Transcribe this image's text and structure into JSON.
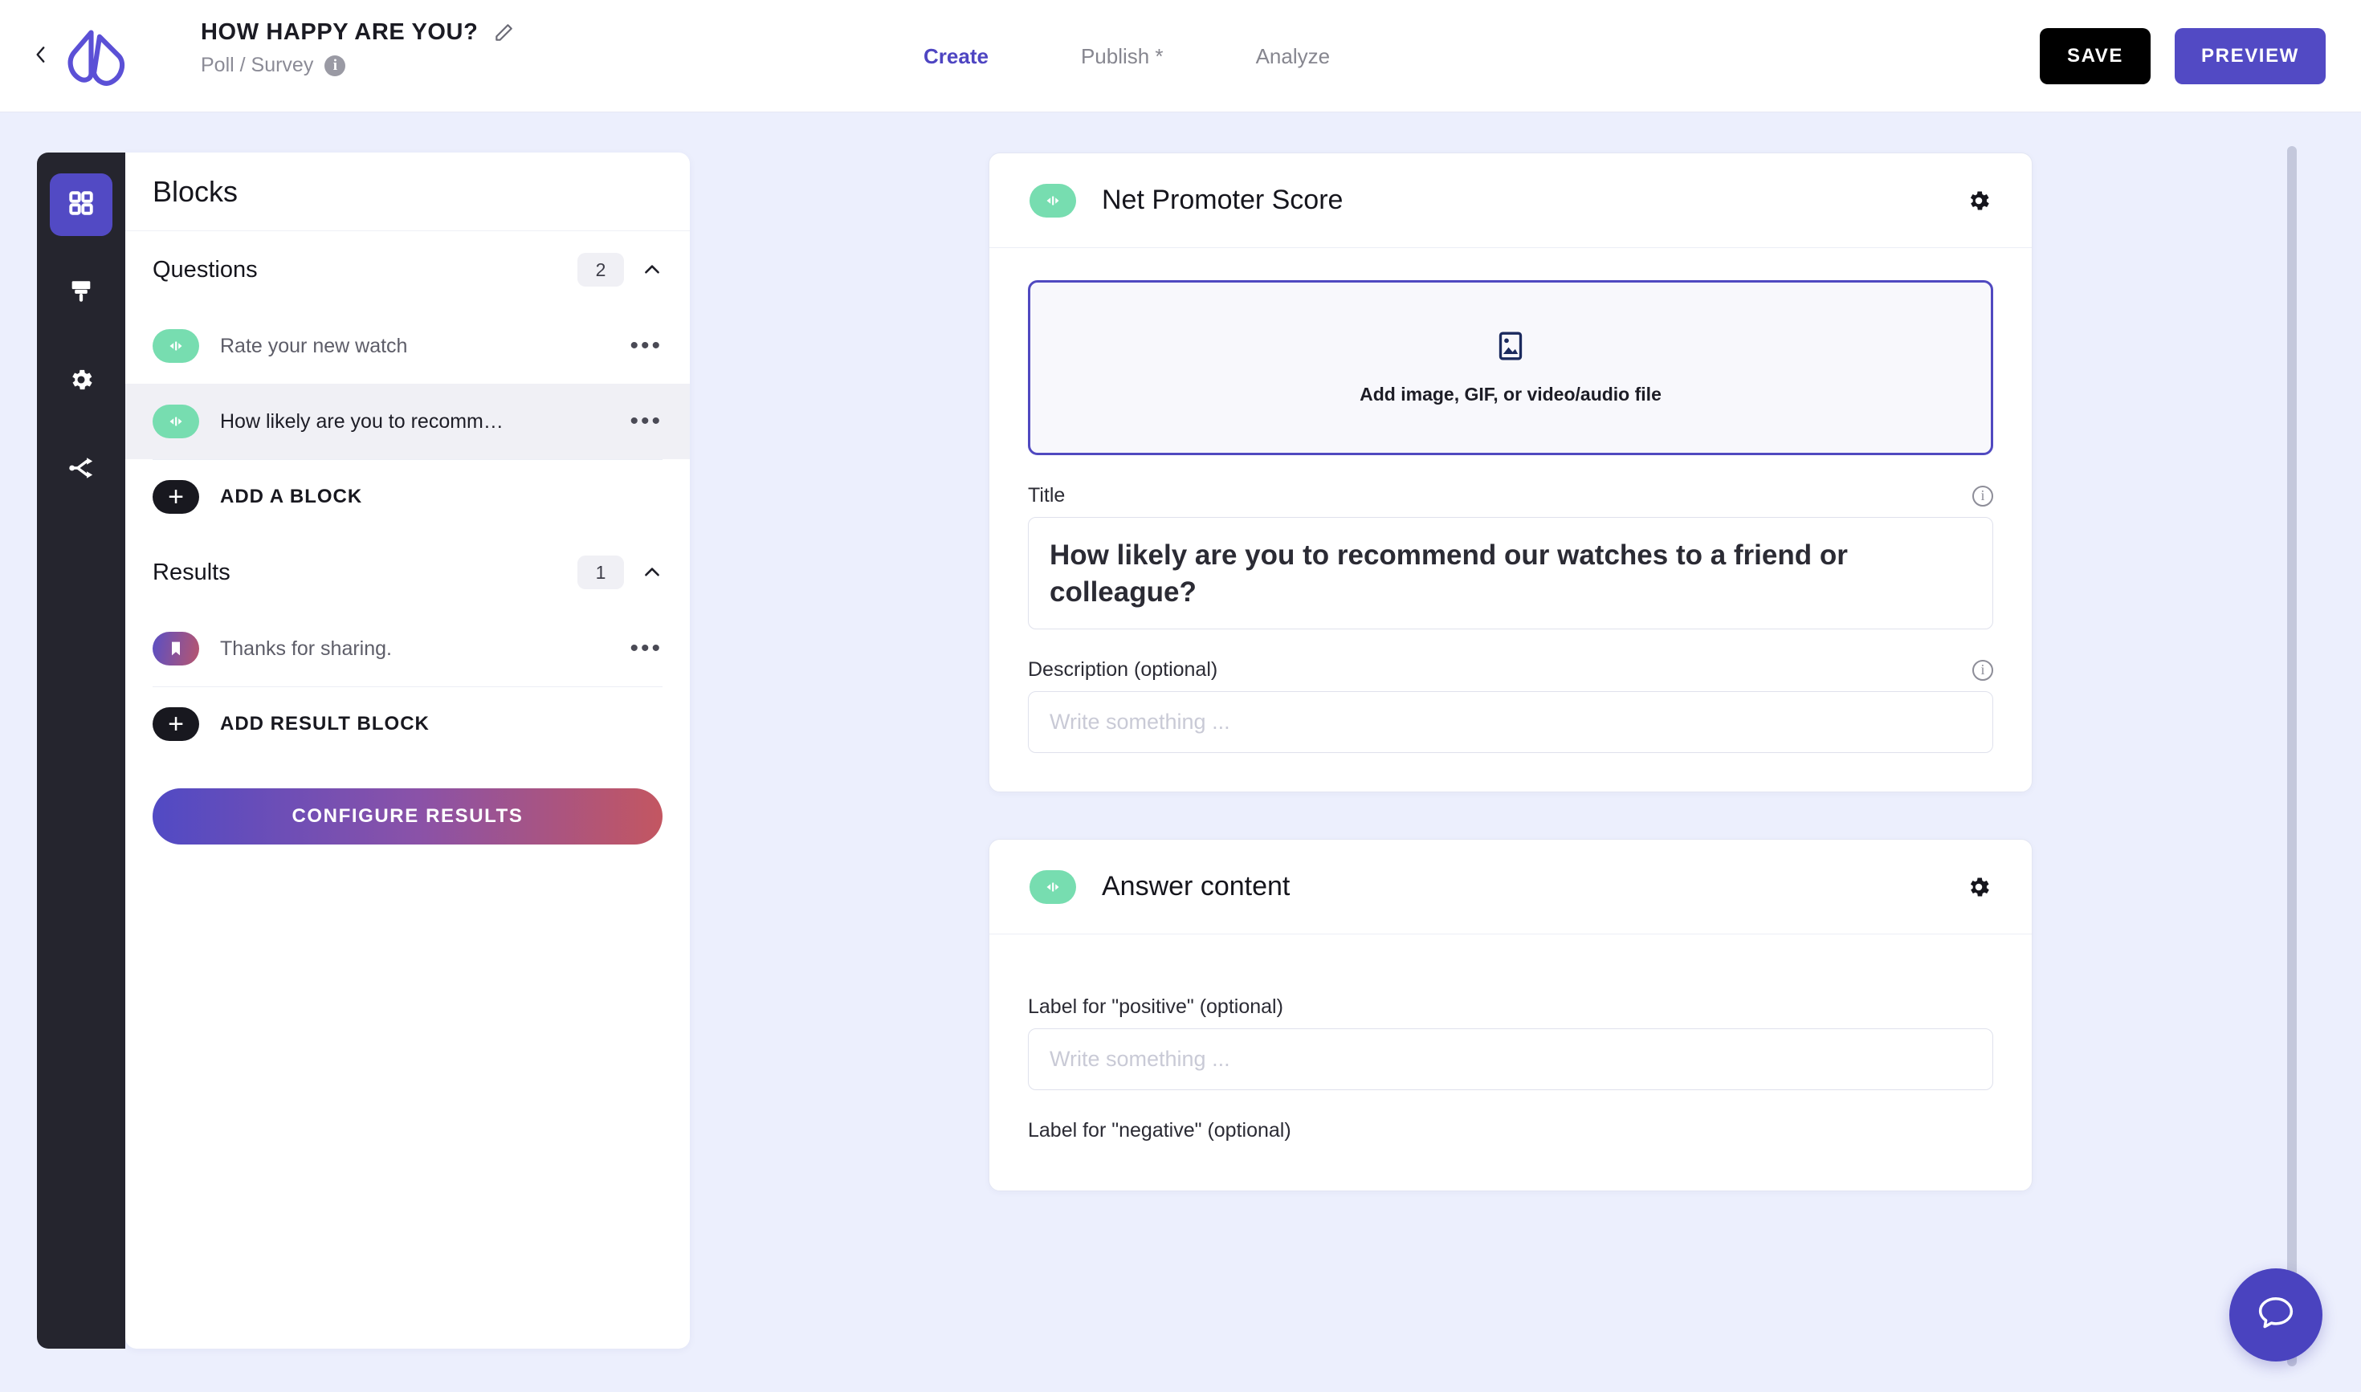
{
  "header": {
    "back_icon": "chevron-left-icon",
    "logo_icon": "brand-logo-icon",
    "title": "HOW HAPPY ARE YOU?",
    "edit_icon": "pencil-icon",
    "subtitle": "Poll / Survey",
    "info_icon": "info-icon",
    "info_glyph": "i",
    "tabs": [
      {
        "label": "Create",
        "active": true
      },
      {
        "label": "Publish *",
        "active": false
      },
      {
        "label": "Analyze",
        "active": false
      }
    ],
    "save_label": "SAVE",
    "preview_label": "PREVIEW"
  },
  "rail": {
    "items": [
      {
        "icon": "blocks-grid-icon",
        "active": true
      },
      {
        "icon": "paintbrush-icon",
        "active": false
      },
      {
        "icon": "gear-icon",
        "active": false
      },
      {
        "icon": "share-branch-icon",
        "active": false
      }
    ]
  },
  "blocks_panel": {
    "heading": "Blocks",
    "questions_section": {
      "title": "Questions",
      "count": "2",
      "collapse_icon": "chevron-up-icon",
      "items": [
        {
          "label": "Rate your new watch",
          "icon": "nps-slider-icon",
          "selected": false,
          "menu_icon": "more-dots-icon"
        },
        {
          "label": "How likely are you to recomm…",
          "icon": "nps-slider-icon",
          "selected": true,
          "menu_icon": "more-dots-icon"
        }
      ],
      "add_label": "ADD A BLOCK",
      "add_icon": "plus-icon"
    },
    "results_section": {
      "title": "Results",
      "count": "1",
      "collapse_icon": "chevron-up-icon",
      "items": [
        {
          "label": "Thanks for sharing.",
          "icon": "bookmark-icon",
          "selected": false,
          "menu_icon": "more-dots-icon"
        }
      ],
      "add_label": "ADD RESULT BLOCK",
      "add_icon": "plus-icon"
    },
    "configure_label": "CONFIGURE RESULTS"
  },
  "editor": {
    "cards": [
      {
        "icon": "nps-slider-icon",
        "title": "Net Promoter Score",
        "gear_icon": "gear-icon",
        "dropzone": {
          "icon": "image-placeholder-icon",
          "label": "Add image, GIF, or video/audio file"
        },
        "title_field": {
          "label": "Title",
          "info_icon": "info-icon",
          "value": "How likely are you to recommend our watches to a friend or colleague?"
        },
        "description_field": {
          "label": "Description (optional)",
          "info_icon": "info-icon",
          "placeholder": "Write something ..."
        }
      },
      {
        "icon": "nps-slider-icon",
        "title": "Answer content",
        "gear_icon": "gear-icon",
        "positive_field": {
          "label": "Label for \"positive\" (optional)",
          "placeholder": "Write something ..."
        },
        "negative_field": {
          "label": "Label for \"negative\" (optional)"
        }
      }
    ]
  },
  "chat": {
    "icon": "chat-bubble-icon"
  },
  "scrollbar": {
    "name": "vertical-scrollbar"
  },
  "colors": {
    "accent_purple": "#524ac4",
    "mint_green": "#77ddb0",
    "dark_rail": "#25252e",
    "page_bg": "#eceffd",
    "black_button": "#000000"
  }
}
